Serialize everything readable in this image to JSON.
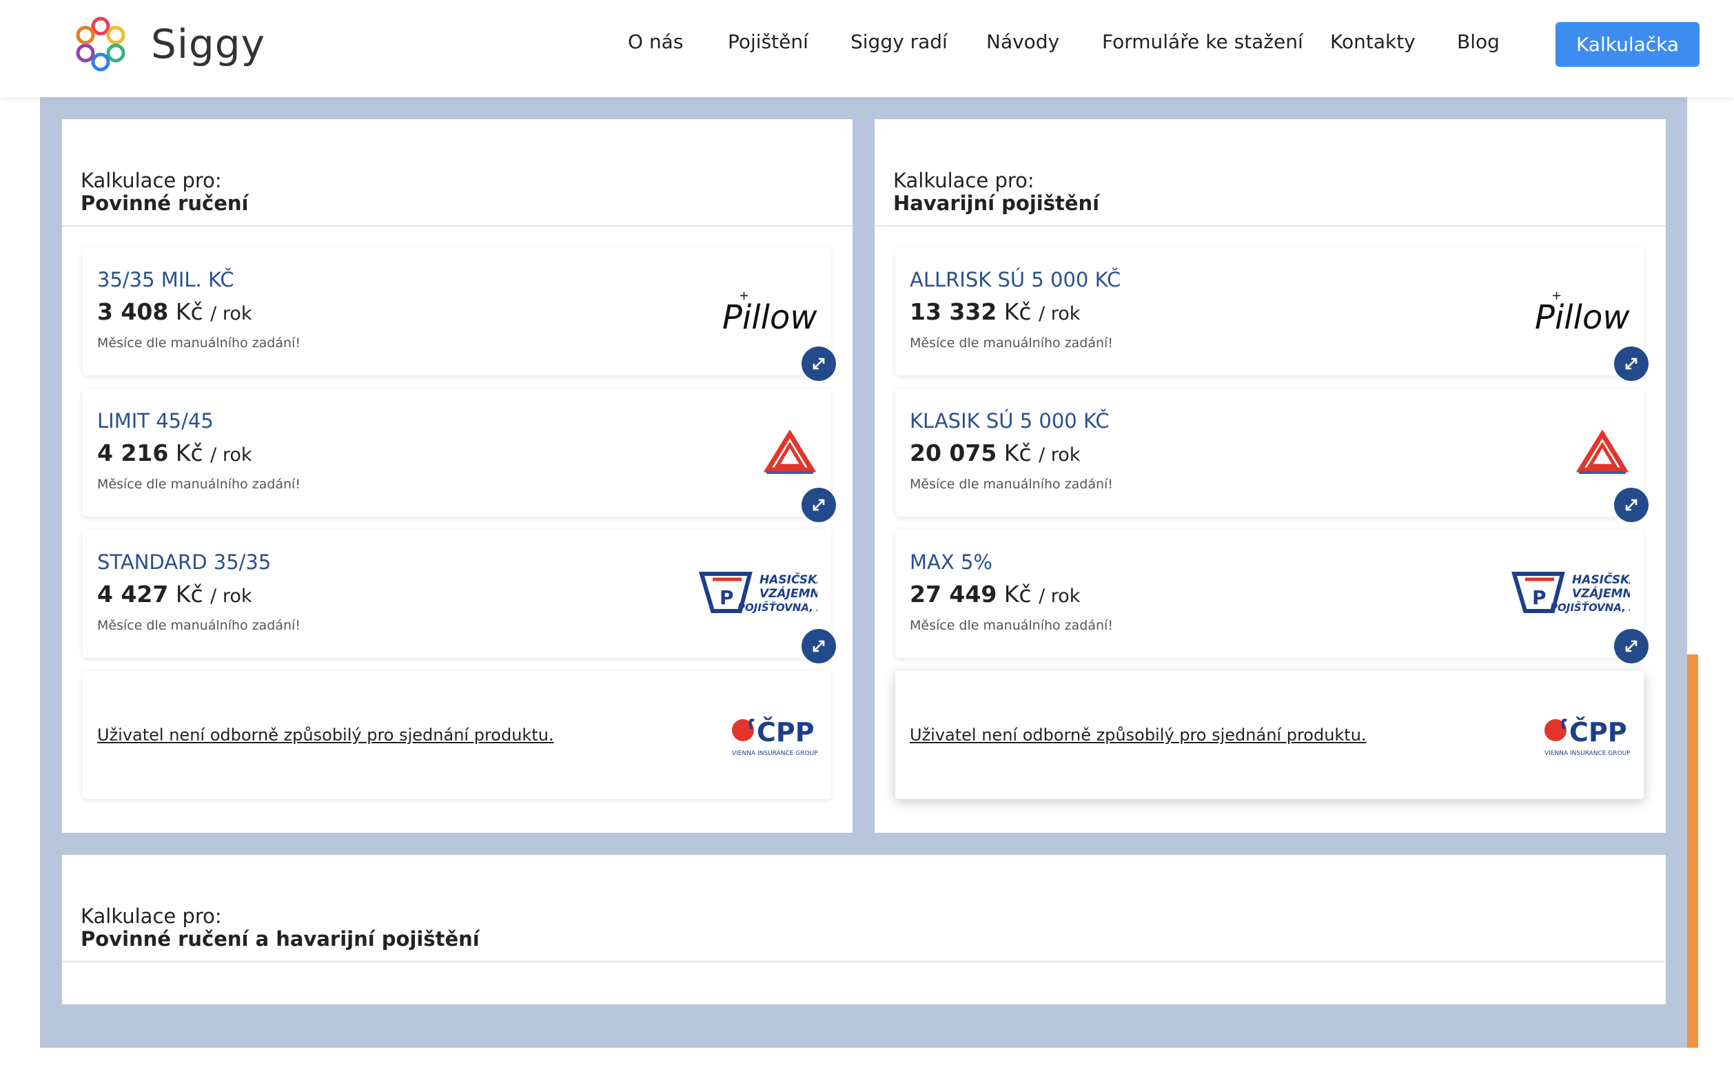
{
  "header": {
    "brand": "Siggy",
    "nav": [
      "O nás",
      "Pojištění",
      "Siggy radí",
      "Návody",
      "Formuláře ke stažení",
      "Kontakty",
      "Blog"
    ],
    "cta": "Kalkulačka"
  },
  "colors": {
    "accent": "#3d8cf0",
    "stage": "#b8c6dd",
    "plan_text": "#2a4f8e",
    "expand_button": "#234b8c",
    "side_accent": "#f0923e"
  },
  "panels": [
    {
      "label": "Kalkulace pro:",
      "title": "Povinné ručení",
      "offers": [
        {
          "plan": "35/35 MIL. KČ",
          "price": "3 408",
          "currency": "Kč",
          "period": "/ rok",
          "note": "Měsíce dle manuálního zadání!",
          "insurer": "Pillow"
        },
        {
          "plan": "LIMIT 45/45",
          "price": "4 216",
          "currency": "Kč",
          "period": "/ rok",
          "note": "Měsíce dle manuálního zadání!",
          "insurer": "Kooperativa"
        },
        {
          "plan": "STANDARD 35/35",
          "price": "4 427",
          "currency": "Kč",
          "period": "/ rok",
          "note": "Měsíce dle manuálního zadání!",
          "insurer": "Hasičská vzájemná pojišťovna, a.s."
        }
      ],
      "notice": {
        "text": "Uživatel není odborně způsobilý pro sjednání produktu.",
        "insurer": "ČPP"
      }
    },
    {
      "label": "Kalkulace pro:",
      "title": "Havarijní pojištění",
      "offers": [
        {
          "plan": "ALLRISK SÚ 5 000 KČ",
          "price": "13 332",
          "currency": "Kč",
          "period": "/ rok",
          "note": "Měsíce dle manuálního zadání!",
          "insurer": "Pillow"
        },
        {
          "plan": "KLASIK SÚ 5 000 KČ",
          "price": "20 075",
          "currency": "Kč",
          "period": "/ rok",
          "note": "Měsíce dle manuálního zadání!",
          "insurer": "Kooperativa"
        },
        {
          "plan": "MAX 5%",
          "price": "27 449",
          "currency": "Kč",
          "period": "/ rok",
          "note": "Měsíce dle manuálního zadání!",
          "insurer": "Hasičská vzájemná pojišťovna, a.s."
        }
      ],
      "notice": {
        "text": "Uživatel není odborně způsobilý pro sjednání produktu.",
        "insurer": "ČPP"
      }
    },
    {
      "label": "Kalkulace pro:",
      "title": "Povinné ručení a havarijní pojištění"
    }
  ],
  "logos": {
    "pillow": "Pillow",
    "hasicska": [
      "HASIČSKÁ",
      "VZÁJEMNÁ",
      "POJIŠŤOVNA, A.S."
    ],
    "cpp": "ČPP",
    "cpp_sub": "VIENNA INSURANCE GROUP"
  }
}
